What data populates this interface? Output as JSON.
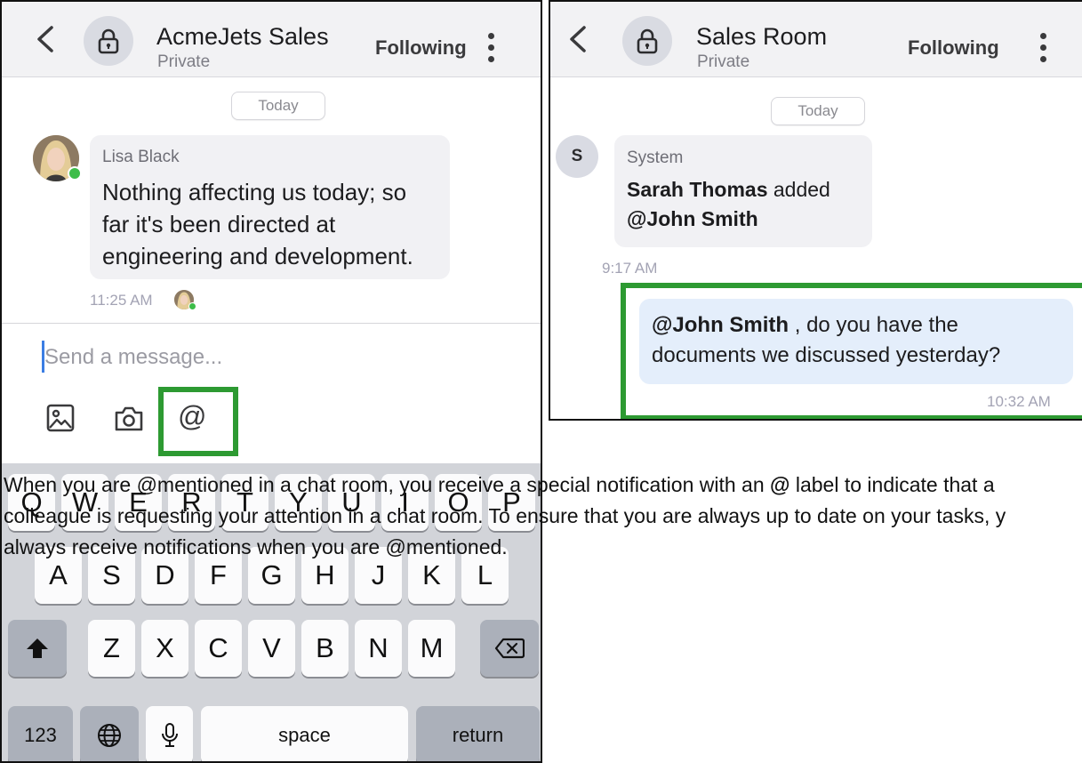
{
  "left_phone": {
    "header": {
      "title": "AcmeJets Sales",
      "subtitle": "Private",
      "following": "Following"
    },
    "date_pill": "Today",
    "message": {
      "sender": "Lisa Black",
      "lines": [
        "Nothing affecting us today; so",
        "far it's been directed at",
        "engineering and development."
      ],
      "time": "11:25 AM"
    },
    "composer": {
      "placeholder": "Send a message..."
    },
    "toolbar_icons": [
      "image-icon",
      "camera-icon",
      "at-mention-icon"
    ],
    "at_symbol": "@",
    "keyboard": {
      "row1": [
        "Q",
        "W",
        "E",
        "R",
        "T",
        "Y",
        "U",
        "I",
        "O",
        "P"
      ],
      "row2": [
        "A",
        "S",
        "D",
        "F",
        "G",
        "H",
        "J",
        "K",
        "L"
      ],
      "row3": [
        "Z",
        "X",
        "C",
        "V",
        "B",
        "N",
        "M"
      ],
      "numbers": "123",
      "space": "space",
      "return": "return"
    }
  },
  "right_phone": {
    "header": {
      "title": "Sales Room",
      "subtitle": "Private",
      "following": "Following"
    },
    "date_pill": "Today",
    "system_message": {
      "avatar_letter": "S",
      "sender": "System",
      "actor": "Sarah Thomas",
      "action": " added",
      "target": "@John Smith",
      "time": "9:17 AM"
    },
    "my_message": {
      "mention": "@John Smith",
      "line1_rest": " , do you have the",
      "line2": "documents we discussed yesterday?",
      "time": "10:32 AM"
    }
  },
  "caption": {
    "line1_pre": "When you are @mentioned in a chat room, you receive a special notification with an ",
    "line1_at": "@",
    "line1_post": " label to indicate that a",
    "line2": "colleague is requesting your attention in a chat room. To ensure that you are always up to date on your tasks, y",
    "line3": "always receive notifications when you are @mentioned."
  },
  "colors": {
    "highlight_green": "#2d9a32",
    "online_green": "#3dbd49",
    "cursor_blue": "#3b7de3",
    "my_bubble": "#e4eefb"
  }
}
